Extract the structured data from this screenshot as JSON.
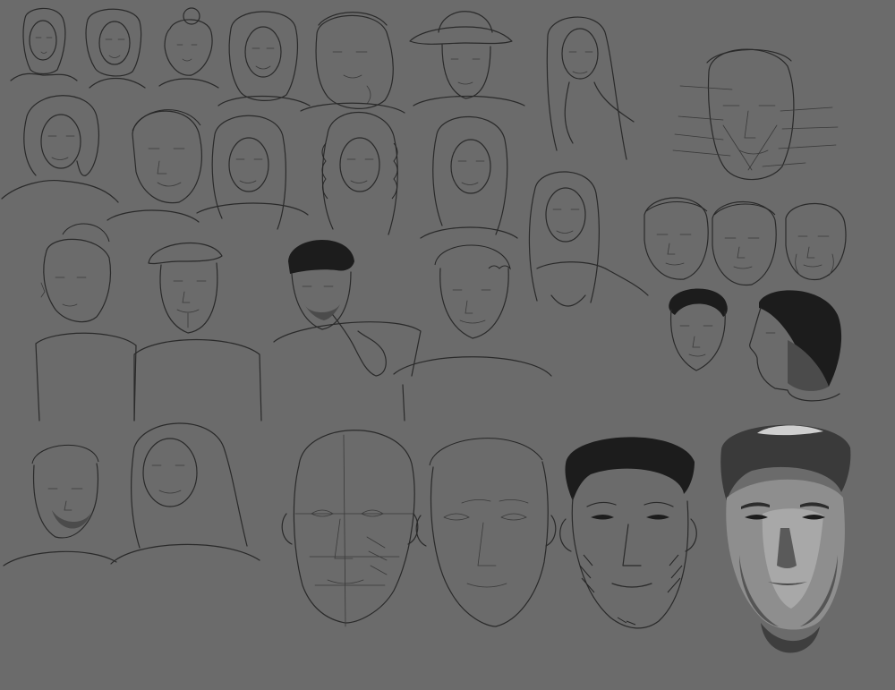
{
  "canvas": {
    "background": "#6b6b6b",
    "line_color": "#2a2a2a"
  },
  "studies": {
    "row1": [
      "portrait-woman-1",
      "portrait-woman-2",
      "portrait-woman-bun",
      "portrait-woman-3",
      "portrait-man-heavy",
      "portrait-man-cowboy-hat",
      "portrait-woman-long-hair"
    ],
    "row2": [
      "portrait-woman-bob",
      "portrait-man-smiling",
      "portrait-woman-4",
      "portrait-woman-curly",
      "portrait-woman-ponytail",
      "portrait-woman-side-braid"
    ],
    "row3": [
      "portrait-man-mohawk",
      "portrait-man-flat-cap",
      "portrait-man-beanie-gesture",
      "portrait-man-curly-hair"
    ],
    "row4": [
      "portrait-man-beard",
      "portrait-woman-long-straight",
      "head-construction-sketch",
      "head-line-sketch",
      "head-ink-hatched",
      "head-painted-greyscale"
    ],
    "right_cluster": [
      "anatomy-notes-head",
      "head-male-1",
      "head-male-2",
      "head-male-older",
      "head-male-small-front",
      "head-male-profile-shaded"
    ]
  }
}
